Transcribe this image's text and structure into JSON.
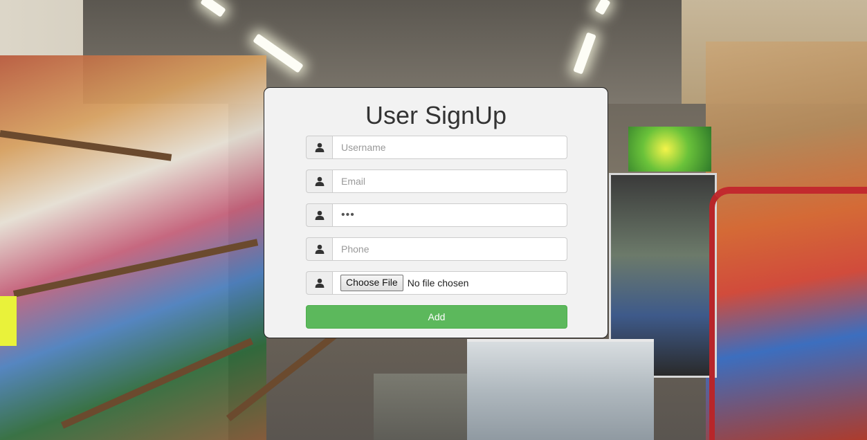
{
  "form": {
    "title": "User SignUp",
    "fields": [
      {
        "name": "username",
        "placeholder": "Username",
        "value": "",
        "icon": "user-icon"
      },
      {
        "name": "email",
        "placeholder": "Email",
        "value": "",
        "icon": "user-icon"
      },
      {
        "name": "password",
        "placeholder": "",
        "value": "•••",
        "icon": "user-icon"
      },
      {
        "name": "phone",
        "placeholder": "Phone",
        "value": "",
        "icon": "user-icon"
      }
    ],
    "file": {
      "button_label": "Choose File",
      "status": "No file chosen",
      "icon": "user-icon"
    },
    "submit_label": "Add"
  },
  "colors": {
    "card_bg": "#f2f2f2",
    "button_green": "#5cb85c",
    "addon_bg": "#eeeeee",
    "title_text": "#333333"
  }
}
